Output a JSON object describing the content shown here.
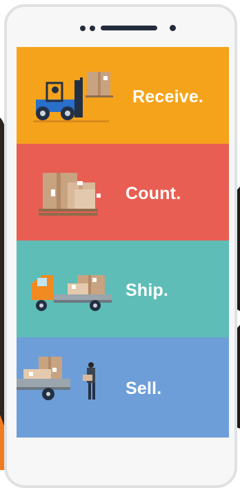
{
  "colors": {
    "receive": "#f6a31c",
    "count": "#e85e52",
    "ship": "#5ebdb7",
    "sell": "#6e9ed8",
    "phone_frame": "#dfe1e3",
    "dark": "#232c3b"
  },
  "panels": [
    {
      "id": "receive",
      "label": "Receive.",
      "icon": "forklift-icon"
    },
    {
      "id": "count",
      "label": "Count.",
      "icon": "pallet-boxes-icon"
    },
    {
      "id": "ship",
      "label": "Ship.",
      "icon": "delivery-truck-icon"
    },
    {
      "id": "sell",
      "label": "Sell.",
      "icon": "salesperson-trailer-icon"
    }
  ]
}
